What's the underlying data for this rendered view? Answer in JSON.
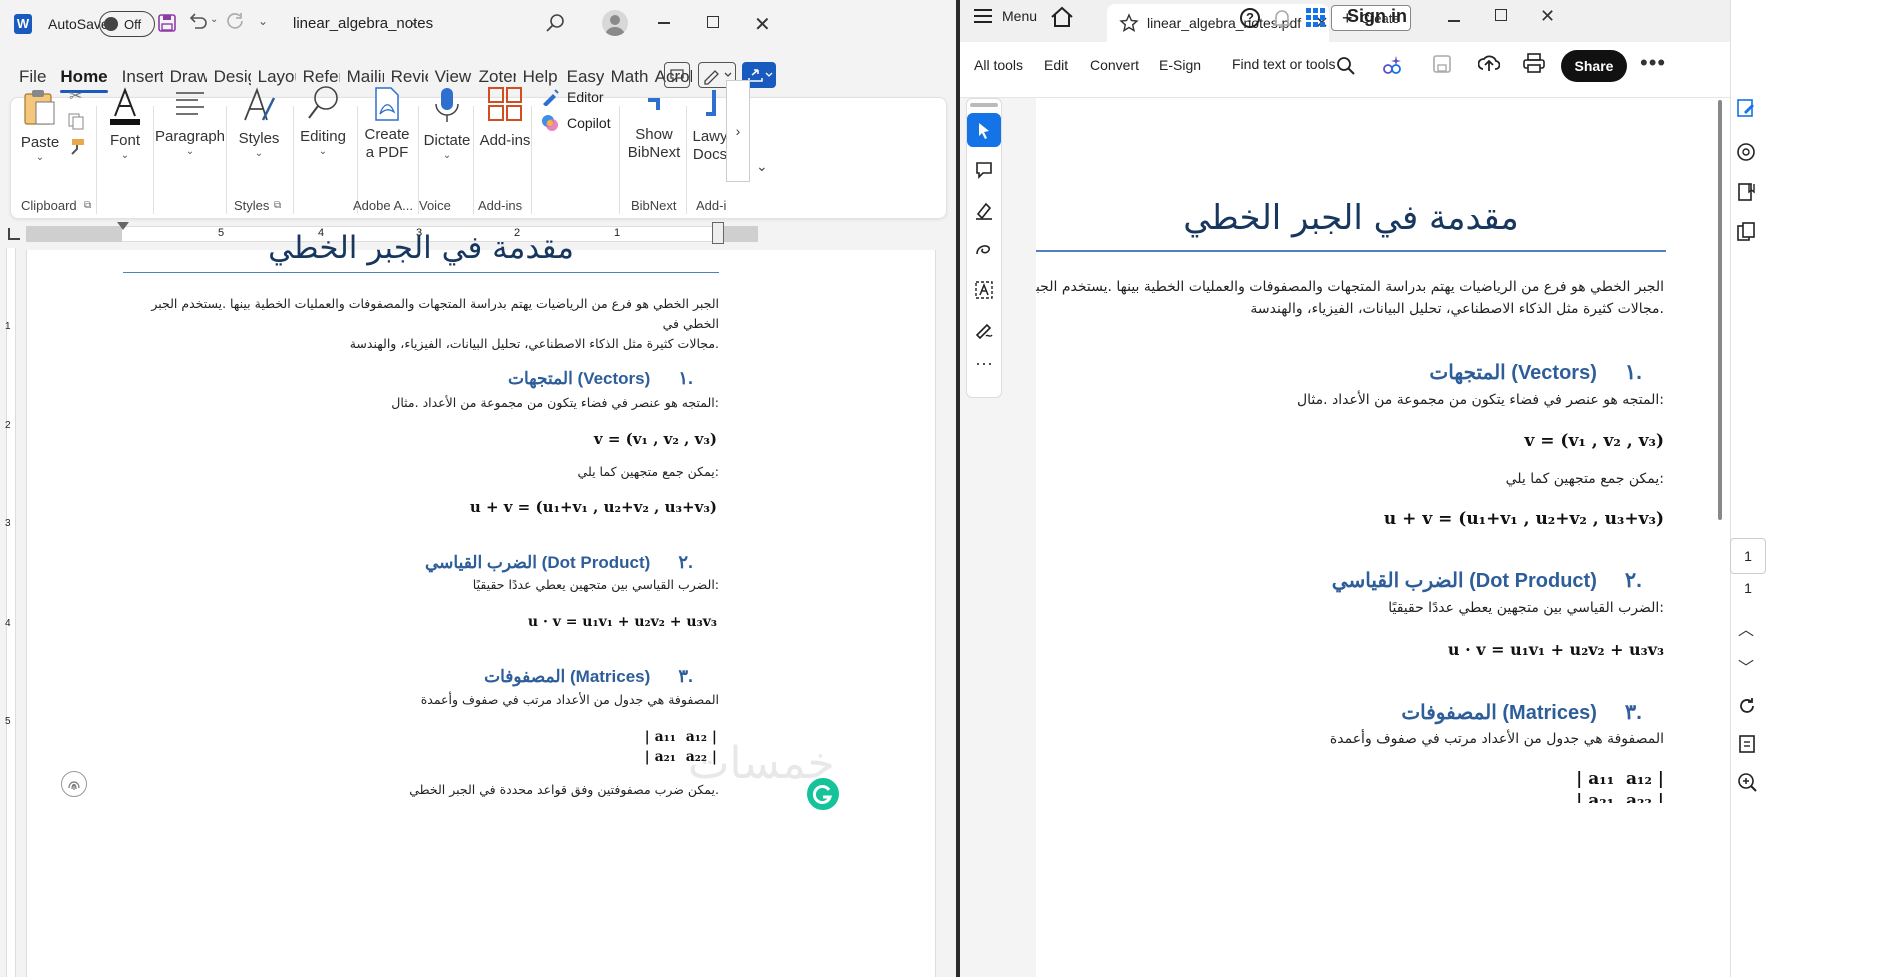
{
  "word": {
    "autosave_label": "AutoSave",
    "autosave_state": "Off",
    "doc_name": "linear_algebra_notes",
    "tabs": [
      "File",
      "Home",
      "Insert",
      "Draw",
      "Desig",
      "Layou",
      "Refere",
      "Mailin",
      "Reviev",
      "View",
      "Zoter",
      "Help",
      "Easy C",
      "MathT",
      "Acrob"
    ],
    "ribbon": {
      "paste": "Paste",
      "font": "Font",
      "paragraph": "Paragraph",
      "styles": "Styles",
      "editing": "Editing",
      "create_pdf": "Create a PDF",
      "dictate": "Dictate",
      "addins": "Add-ins",
      "editor": "Editor",
      "copilot": "Copilot",
      "show_bibnext": "Show BibNext",
      "lawyer_docs": "Lawy Docs",
      "groups": {
        "clipboard": "Clipboard",
        "styles": "Styles",
        "adobe": "Adobe A...",
        "voice": "Voice",
        "addins": "Add-ins",
        "bibnext": "BibNext",
        "addins2": "Add-i"
      }
    },
    "ruler_numbers": [
      "5",
      "4",
      "3",
      "2",
      "1"
    ],
    "vruler_numbers": [
      "1",
      "2",
      "3",
      "4",
      "5"
    ]
  },
  "doc": {
    "title": "مقدمة في الجبر الخطي",
    "intro": "الجبر الخطي هو فرع من الرياضيات يهتم بدراسة المتجهات والمصفوفات والعمليات الخطية بينها .يستخدم الجبر الخطي في مجالات كثيرة مثل الذكاء الاصطناعي، تحليل البيانات، الفيزياء، والهندسة.",
    "intro_line1": "الجبر الخطي هو فرع من الرياضيات يهتم بدراسة المتجهات والمصفوفات والعمليات الخطية بينها .يستخدم الجبر الخطي في",
    "intro_line2": ".مجالات كثيرة مثل الذكاء الاصطناعي، تحليل البيانات، الفيزياء، والهندسة",
    "s1_num": ".١",
    "s1_heading": "(Vectors) المتجهات",
    "s1_text": ":المتجه هو عنصر في فضاء يتكون من مجموعة من الأعداد .مثال",
    "s1_formula": "v = (v₁ , v₂ , v₃)",
    "s1_text2": ":يمكن جمع متجهين كما يلي",
    "s1_formula2": "u + v = (u₁+v₁ , u₂+v₂ , u₃+v₃)",
    "s2_num": ".٢",
    "s2_heading": "(Dot Product) الضرب القياسي",
    "s2_text": ":الضرب القياسي بين متجهين يعطي عددًا حقيقيًا",
    "s2_formula": "u · v = u₁v₁ + u₂v₂ + u₃v₃",
    "s3_num": ".٣",
    "s3_heading": "(Matrices) المصفوفات",
    "s3_text": "المصفوفة هي جدول من الأعداد مرتب في صفوف وأعمدة",
    "s3_matrix_row1": "| a₁₁  a₁₂ |",
    "s3_matrix_row2": "| a₂₁  a₂₂ |",
    "s3_text2": ".يمكن ضرب مصفوفتين وفق قواعد محددة في الجبر الخطي"
  },
  "acrobat": {
    "menu_label": "Menu",
    "tab_name": "linear_algebra_notes.pdf",
    "create_label": "Create",
    "sign_in": "Sign in",
    "toolbar": {
      "all_tools": "All tools",
      "edit": "Edit",
      "convert": "Convert",
      "esign": "E-Sign",
      "find": "Find text or tools",
      "share": "Share"
    },
    "page_number": "1",
    "page_total": "1"
  },
  "watermark": "خمسات"
}
